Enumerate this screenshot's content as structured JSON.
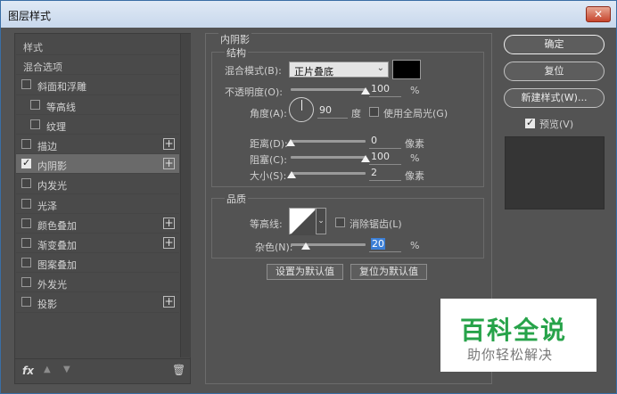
{
  "window": {
    "title": "图层样式",
    "close_glyph": "✕"
  },
  "left": {
    "items": [
      {
        "label": "样式",
        "type": "head"
      },
      {
        "label": "混合选项",
        "type": "opts"
      },
      {
        "label": "斜面和浮雕",
        "type": "check",
        "checked": false,
        "plus": false,
        "sub": false
      },
      {
        "label": "等高线",
        "type": "check",
        "checked": false,
        "plus": false,
        "sub": true
      },
      {
        "label": "纹理",
        "type": "check",
        "checked": false,
        "plus": false,
        "sub": true
      },
      {
        "label": "描边",
        "type": "check",
        "checked": false,
        "plus": true,
        "sub": false
      },
      {
        "label": "内阴影",
        "type": "check",
        "checked": true,
        "plus": true,
        "sub": false,
        "active": true
      },
      {
        "label": "内发光",
        "type": "check",
        "checked": false,
        "plus": false,
        "sub": false
      },
      {
        "label": "光泽",
        "type": "check",
        "checked": false,
        "plus": false,
        "sub": false
      },
      {
        "label": "颜色叠加",
        "type": "check",
        "checked": false,
        "plus": true,
        "sub": false
      },
      {
        "label": "渐变叠加",
        "type": "check",
        "checked": false,
        "plus": true,
        "sub": false
      },
      {
        "label": "图案叠加",
        "type": "check",
        "checked": false,
        "plus": false,
        "sub": false
      },
      {
        "label": "外发光",
        "type": "check",
        "checked": false,
        "plus": false,
        "sub": false
      },
      {
        "label": "投影",
        "type": "check",
        "checked": false,
        "plus": true,
        "sub": false
      }
    ],
    "footer": {
      "fx": "fx",
      "up": "▲",
      "down": "▼",
      "trash": "🗑"
    }
  },
  "inner_shadow": {
    "title": "内阴影",
    "structure": {
      "title": "结构",
      "blend_mode_label": "混合模式(B):",
      "blend_mode_value": "正片叠底",
      "blend_color": "#000000",
      "opacity_label": "不透明度(O):",
      "opacity_value": "100",
      "opacity_unit": "%",
      "opacity_fraction": 1.0,
      "angle_label": "角度(A):",
      "angle_value": "90",
      "angle_unit": "度",
      "global_light_label": "使用全局光(G)",
      "global_light_checked": false,
      "distance_label": "距离(D):",
      "distance_value": "0",
      "distance_unit": "像素",
      "distance_fraction": 0.0,
      "choke_label": "阻塞(C):",
      "choke_value": "100",
      "choke_unit": "%",
      "choke_fraction": 1.0,
      "size_label": "大小(S):",
      "size_value": "2",
      "size_unit": "像素",
      "size_fraction": 0.01
    },
    "quality": {
      "title": "品质",
      "contour_label": "等高线:",
      "antialias_label": "消除锯齿(L)",
      "antialias_checked": false,
      "noise_label": "杂色(N):",
      "noise_value": "20",
      "noise_unit": "%",
      "noise_fraction": 0.2
    },
    "set_default_label": "设置为默认值",
    "reset_default_label": "复位为默认值"
  },
  "right": {
    "ok_label": "确定",
    "reset_label": "复位",
    "new_style_label": "新建样式(W)...",
    "preview_label": "预览(V)",
    "preview_checked": true
  },
  "watermark": {
    "line1": "百科全说",
    "line2": "助你轻松解决"
  }
}
